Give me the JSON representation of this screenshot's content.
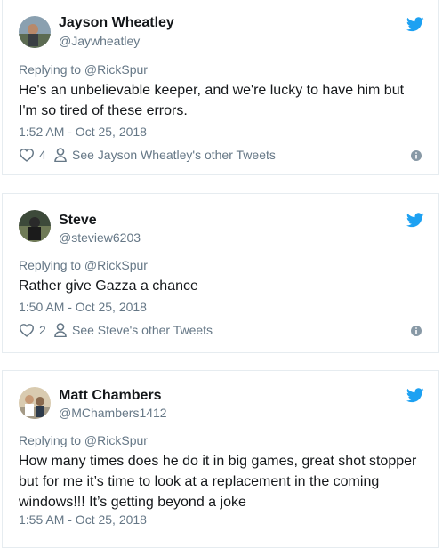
{
  "tweets": [
    {
      "name": "Jayson Wheatley",
      "handle": "@Jaywheatley",
      "replying_to": "Replying to @RickSpur",
      "text": "He's an unbelievable keeper, and we're lucky to have him but I'm so tired of these errors.",
      "time": "1:52 AM - Oct 25, 2018",
      "likes": "4",
      "other_tweets": "See Jayson Wheatley's other Tweets"
    },
    {
      "name": "Steve",
      "handle": "@steview6203",
      "replying_to": "Replying to @RickSpur",
      "text": "Rather give Gazza a chance",
      "time": "1:50 AM - Oct 25, 2018",
      "likes": "2",
      "other_tweets": "See Steve's other Tweets"
    },
    {
      "name": "Matt Chambers",
      "handle": "@MChambers1412",
      "replying_to": "Replying to @RickSpur",
      "text": "How many times does he do it in big games, great shot stopper but for me it’s time to look at a replacement in the coming windows!!! It’s getting beyond a joke",
      "time": "1:55 AM - Oct 25, 2018"
    }
  ],
  "icons": {
    "twitter": "twitter-bird-icon",
    "like": "heart-icon",
    "profile": "person-icon",
    "info": "info-icon"
  },
  "colors": {
    "twitter_blue": "#1da1f2",
    "secondary_text": "#657786",
    "border": "#e6ecf0"
  }
}
